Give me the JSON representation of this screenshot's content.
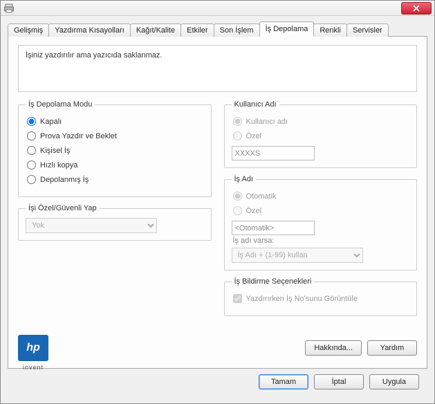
{
  "tabs": [
    "Gelişmiş",
    "Yazdırma Kısayolları",
    "Kağıt/Kalite",
    "Etkiler",
    "Son İşlem",
    "İş Depolama",
    "Renkli",
    "Servisler"
  ],
  "active_tab_index": 5,
  "description": "İşiniz yazdırılır ama yazıcıda saklanmaz.",
  "storage_mode": {
    "legend": "İş Depolama Modu",
    "options": {
      "off": "Kapalı",
      "proof": "Prova Yazdır ve Beklet",
      "personal": "Kişisel İş",
      "quick": "Hızlı kopya",
      "stored": "Depolanmış İş"
    },
    "selected": "off"
  },
  "make_secure": {
    "legend": "İşi Özel/Güvenli Yap",
    "value": "Yok"
  },
  "user_name": {
    "legend": "Kullanıcı Adı",
    "options": {
      "auto": "Kullanıcı adı",
      "custom": "Özel"
    },
    "selected": "auto",
    "value": "XXXXS"
  },
  "job_name": {
    "legend": "İş Adı",
    "options": {
      "auto": "Otomatik",
      "custom": "Özel"
    },
    "selected": "auto",
    "value": "<Otomatik>",
    "exists_label": "İş adı varsa:",
    "exists_value": "İş Adı + (1-99) kullan"
  },
  "notify": {
    "legend": "İş Bildirme Seçenekleri",
    "checkbox_label": "Yazdırırken İş No'sunu Görüntüle",
    "checked": true
  },
  "hp_invent": "invent",
  "buttons": {
    "about": "Hakkında...",
    "help": "Yardım",
    "ok": "Tamam",
    "cancel": "İptal",
    "apply": "Uygula"
  }
}
